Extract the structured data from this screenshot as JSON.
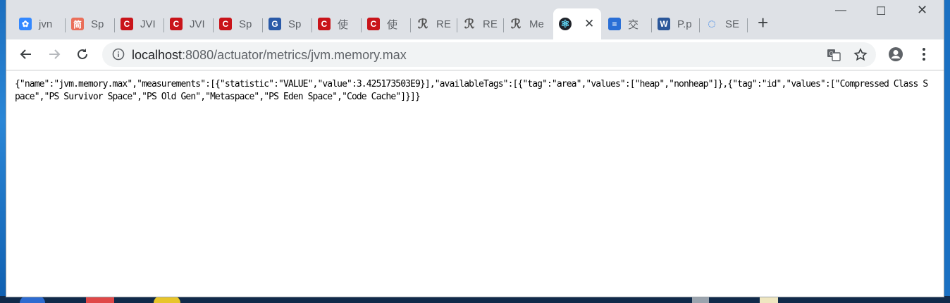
{
  "tabs": [
    {
      "title": "jvn",
      "icon": "paw-icon",
      "color": "#3388ff",
      "glyph": "✿"
    },
    {
      "title": "Sp",
      "icon": "jian-icon",
      "color": "#ea6f5a",
      "glyph": "简"
    },
    {
      "title": "JVI",
      "icon": "csdn-icon",
      "color": "#c9141a",
      "glyph": "C"
    },
    {
      "title": "JVI",
      "icon": "csdn-icon",
      "color": "#c9141a",
      "glyph": "C"
    },
    {
      "title": "Sp",
      "icon": "csdn-icon",
      "color": "#c9141a",
      "glyph": "C"
    },
    {
      "title": "Sp",
      "icon": "cnblogs-icon",
      "color": "#2a5aa8",
      "glyph": "G"
    },
    {
      "title": "使",
      "icon": "csdn-icon",
      "color": "#c9141a",
      "glyph": "C"
    },
    {
      "title": "使",
      "icon": "csdn-icon",
      "color": "#c9141a",
      "glyph": "C"
    },
    {
      "title": "RE",
      "icon": "script-icon",
      "color": "#555555",
      "glyph": "ℛ"
    },
    {
      "title": "RE",
      "icon": "script-icon",
      "color": "#555555",
      "glyph": "ℛ"
    },
    {
      "title": "Me",
      "icon": "script-icon",
      "color": "#555555",
      "glyph": "ℛ"
    }
  ],
  "active_tab": {
    "icon": "react-icon",
    "color": "#61dafb",
    "glyph": "⚛",
    "close": "✕"
  },
  "tabs_after": [
    {
      "title": "交",
      "icon": "database-icon",
      "color": "#2a6fd6",
      "glyph": "≡"
    },
    {
      "title": "P.p",
      "icon": "word-icon",
      "color": "#2b579a",
      "glyph": "W"
    },
    {
      "title": "SE",
      "icon": "loading-icon",
      "color": "#1a73e8",
      "glyph": "◌"
    }
  ],
  "new_tab": "+",
  "window_controls": {
    "minimize": "—",
    "maximize": "☐",
    "close": "✕"
  },
  "nav": {
    "back": "←",
    "forward": "→",
    "reload": "↻"
  },
  "omnibox": {
    "host": "localhost",
    "rest": ":8080/actuator/metrics/jvm.memory.max"
  },
  "body_text": "{\"name\":\"jvm.memory.max\",\"measurements\":[{\"statistic\":\"VALUE\",\"value\":3.425173503E9}],\"availableTags\":[{\"tag\":\"area\",\"values\":[\"heap\",\"nonheap\"]},{\"tag\":\"id\",\"values\":[\"Compressed Class Space\",\"PS Survivor Space\",\"PS Old Gen\",\"Metaspace\",\"PS Eden Space\",\"Code Cache\"]}]}"
}
